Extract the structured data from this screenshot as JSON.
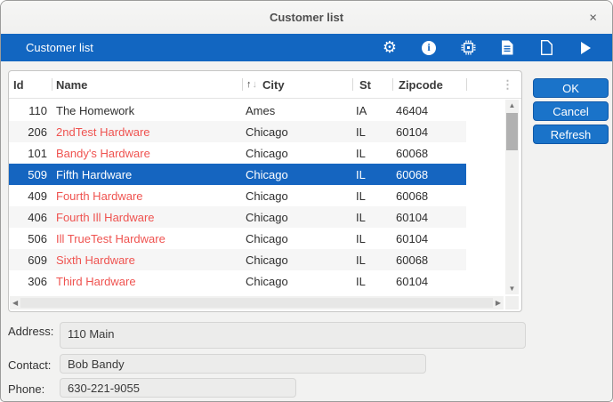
{
  "window": {
    "title": "Customer list",
    "close_glyph": "×"
  },
  "toolbar": {
    "title": "Customer list",
    "gear_glyph": "⚙",
    "info_glyph": "i"
  },
  "table": {
    "columns": {
      "id": "Id",
      "name": "Name",
      "city": "City",
      "st": "St",
      "zipcode": "Zipcode"
    },
    "sort": {
      "column": "City",
      "direction": "ascending",
      "asc_glyph": "↑",
      "desc_glyph": "↓"
    },
    "column_menu_glyph": "⋮",
    "selected_row_id": "509",
    "rows": [
      {
        "id": "110",
        "name": "The Homework",
        "city": "Ames",
        "st": "IA",
        "zipcode": "46404"
      },
      {
        "id": "206",
        "name": "2ndTest Hardware",
        "city": "Chicago",
        "st": "IL",
        "zipcode": "60104"
      },
      {
        "id": "101",
        "name": "Bandy's Hardware",
        "city": "Chicago",
        "st": "IL",
        "zipcode": "60068"
      },
      {
        "id": "509",
        "name": "Fifth Hardware",
        "city": "Chicago",
        "st": "IL",
        "zipcode": "60068"
      },
      {
        "id": "409",
        "name": "Fourth Hardware",
        "city": "Chicago",
        "st": "IL",
        "zipcode": "60068"
      },
      {
        "id": "406",
        "name": "Fourth Ill Hardware",
        "city": "Chicago",
        "st": "IL",
        "zipcode": "60104"
      },
      {
        "id": "506",
        "name": "Ill TrueTest Hardware",
        "city": "Chicago",
        "st": "IL",
        "zipcode": "60104"
      },
      {
        "id": "609",
        "name": "Sixth Hardware",
        "city": "Chicago",
        "st": "IL",
        "zipcode": "60068"
      },
      {
        "id": "306",
        "name": "Third Hardware",
        "city": "Chicago",
        "st": "IL",
        "zipcode": "60104"
      }
    ]
  },
  "scrollbars": {
    "up": "▲",
    "down": "▼",
    "left": "◀",
    "right": "▶"
  },
  "buttons": {
    "ok": "OK",
    "cancel": "Cancel",
    "refresh": "Refresh"
  },
  "fields": {
    "address": {
      "label": "Address:",
      "value": "110 Main"
    },
    "contact": {
      "label": "Contact:",
      "value": "Bob Bandy"
    },
    "phone": {
      "label": "Phone:",
      "value": "630-221-9055"
    }
  },
  "colors": {
    "accent_blue": "#1266c1",
    "selected_row_bg": "#1565c0",
    "name_text_red": "#ef5350",
    "button_blue": "#1a73c9"
  }
}
